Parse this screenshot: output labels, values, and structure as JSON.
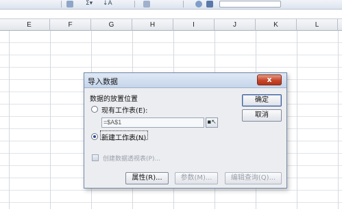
{
  "columns": [
    "E",
    "F",
    "G",
    "H",
    "I",
    "J",
    "K",
    "L"
  ],
  "dialog": {
    "title": "导入数据",
    "close_label": "x",
    "section_label": "数据的放置位置",
    "existing_sheet_label": "现有工作表(E):",
    "existing_sheet_selected": false,
    "cell_reference": "=$A$1",
    "new_sheet_label": "新建工作表(N)",
    "new_sheet_selected": true,
    "pivot_link_label": "创建数据透视表(P)...",
    "ok_label": "确定",
    "cancel_label": "取消",
    "properties_label": "属性(R)...",
    "parameters_label": "参数(M)...",
    "edit_query_label": "编辑查询(Q)..."
  },
  "icons": {
    "collapse": "range-collapse-icon",
    "pivot": "pivot-table-icon"
  }
}
